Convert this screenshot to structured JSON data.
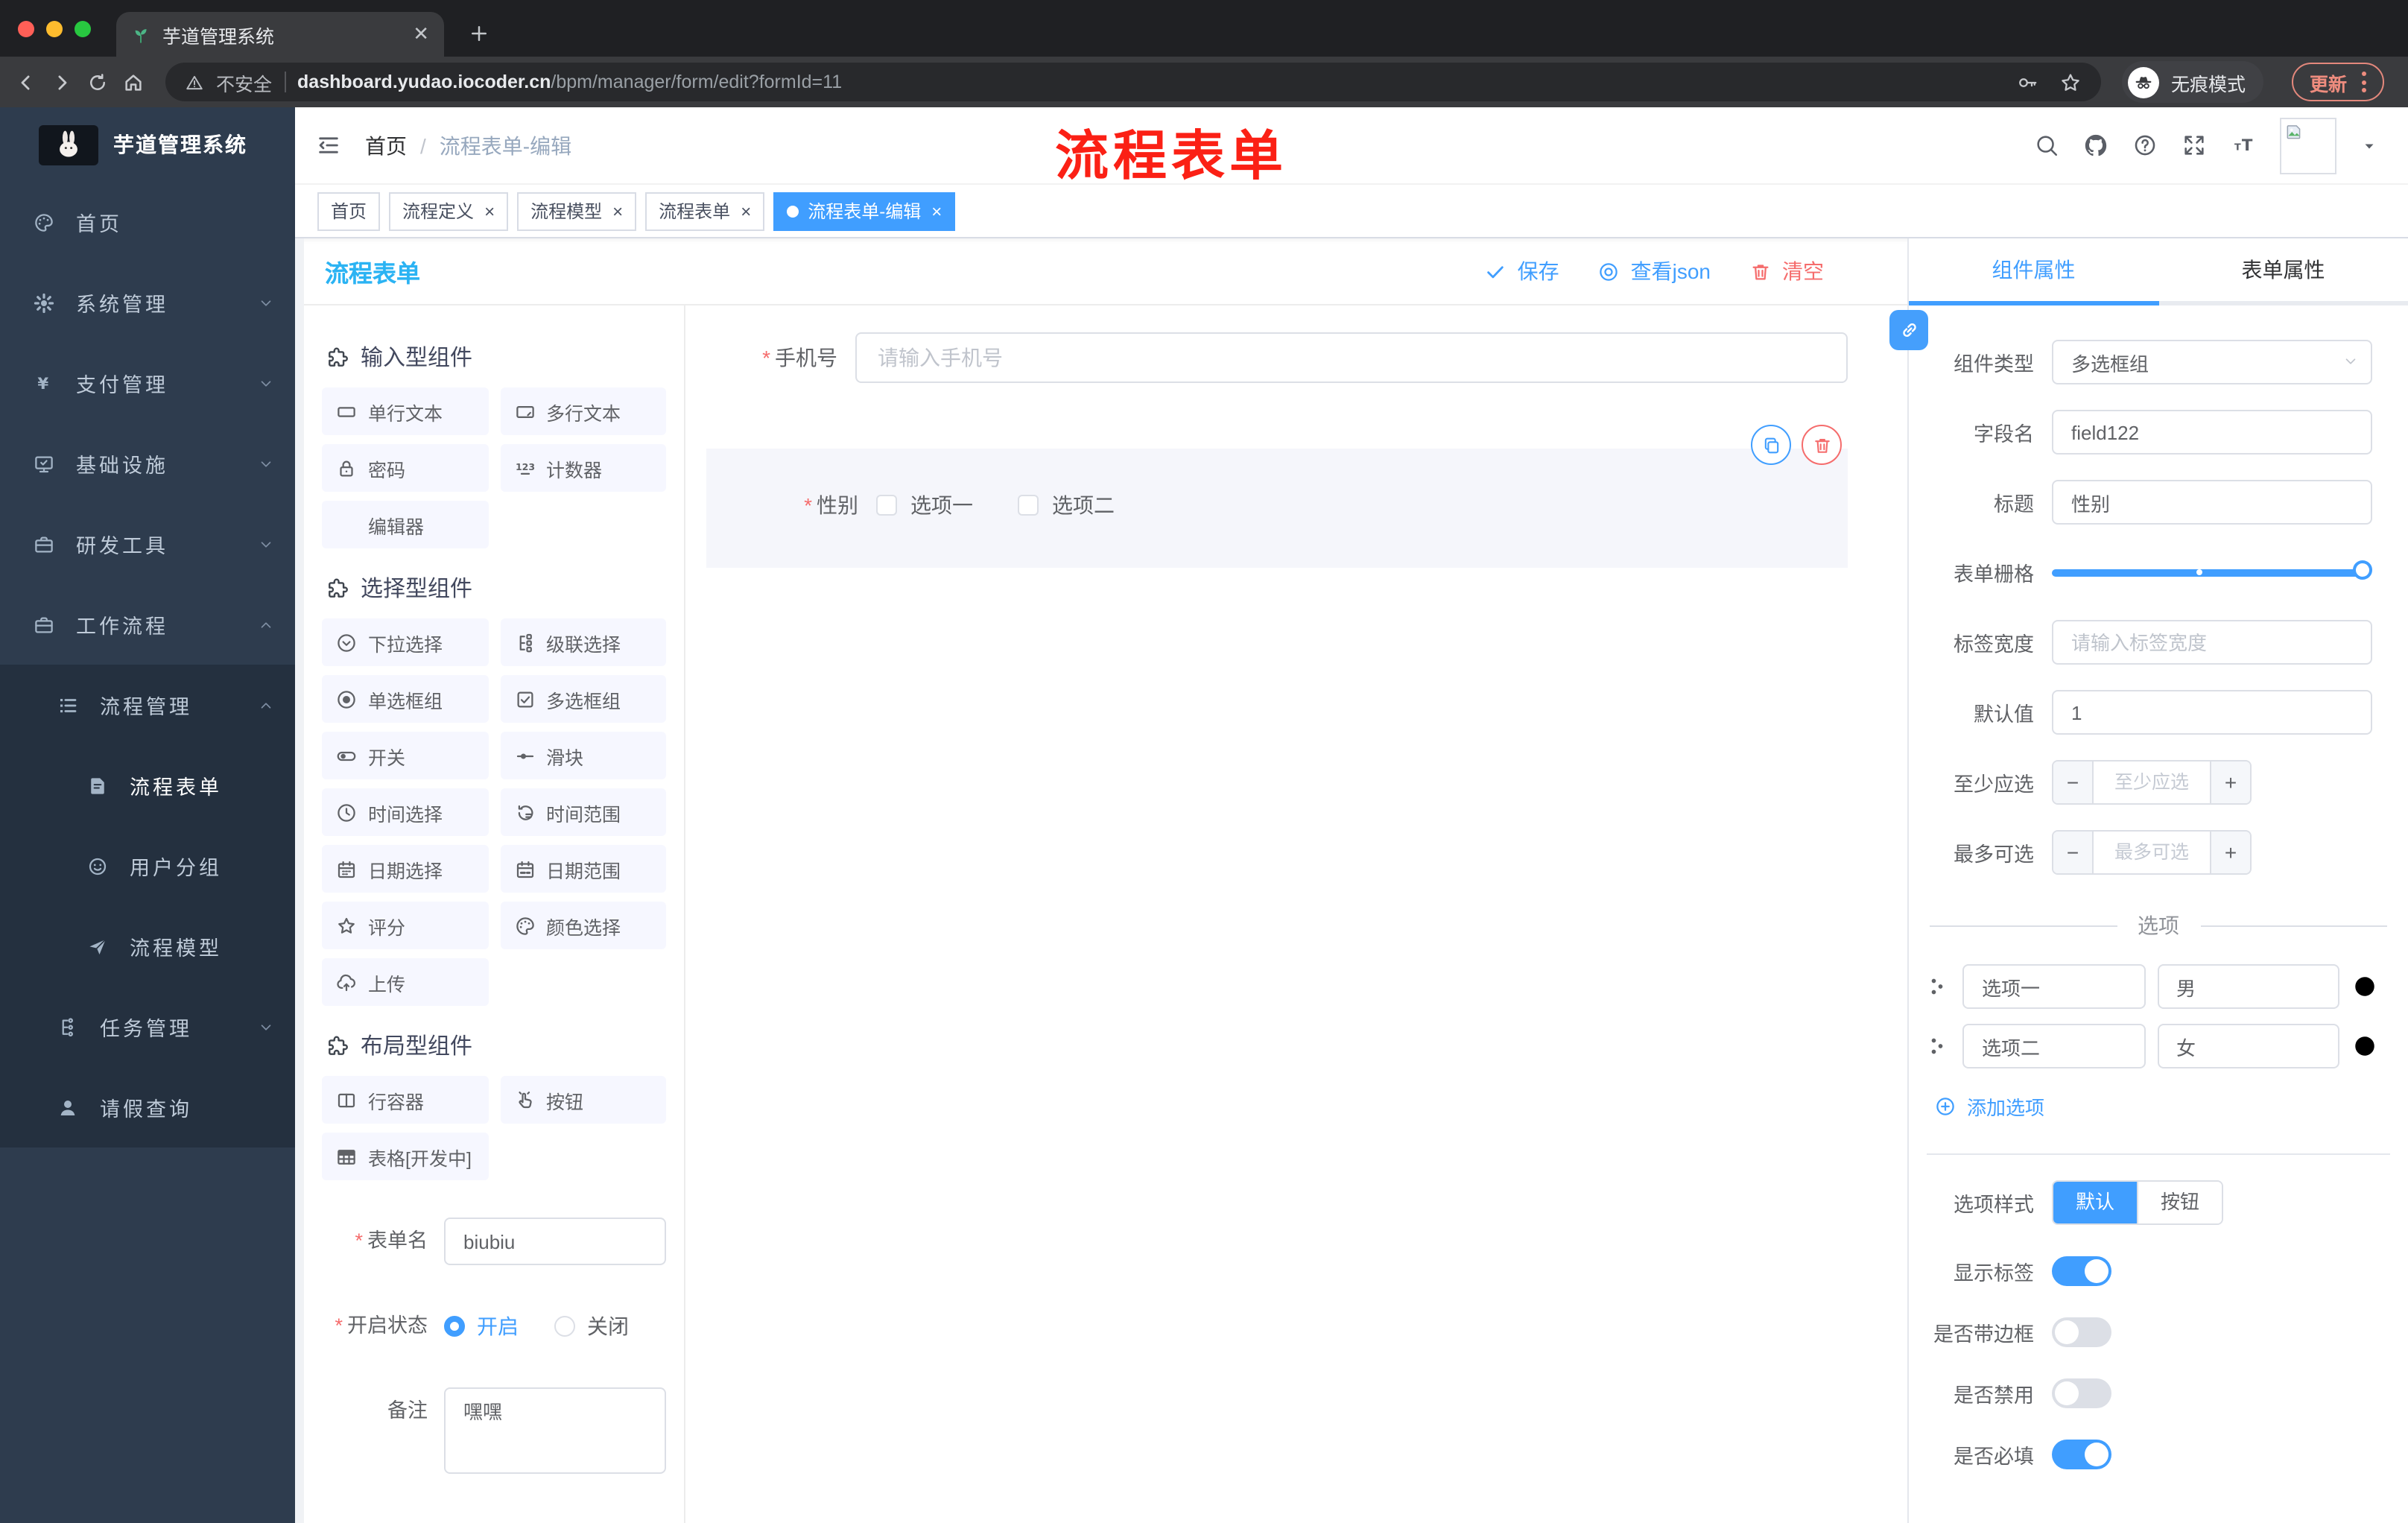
{
  "browser": {
    "tab_title": "芋道管理系统",
    "security_label": "不安全",
    "url_domain": "dashboard.yudao.iocoder.cn",
    "url_path": "/bpm/manager/form/edit?formId=11",
    "incognito_label": "无痕模式",
    "update_label": "更新"
  },
  "sidebar": {
    "logo_title": "芋道管理系统",
    "items": [
      {
        "label": "首页"
      },
      {
        "label": "系统管理"
      },
      {
        "label": "支付管理"
      },
      {
        "label": "基础设施"
      },
      {
        "label": "研发工具"
      },
      {
        "label": "工作流程"
      }
    ],
    "workflow": {
      "process_mgmt": "流程管理",
      "process_form": "流程表单",
      "user_group": "用户分组",
      "process_model": "流程模型",
      "task_mgmt": "任务管理",
      "leave_query": "请假查询"
    }
  },
  "header": {
    "breadcrumb_home": "首页",
    "breadcrumb_sep": "/",
    "breadcrumb_current": "流程表单-编辑",
    "annotation": "流程表单"
  },
  "tabs": [
    {
      "label": "首页",
      "closable": false
    },
    {
      "label": "流程定义",
      "closable": true
    },
    {
      "label": "流程模型",
      "closable": true
    },
    {
      "label": "流程表单",
      "closable": true
    },
    {
      "label": "流程表单-编辑",
      "closable": true,
      "active": true
    }
  ],
  "builder": {
    "title": "流程表单",
    "save_label": "保存",
    "view_json_label": "查看json",
    "clear_label": "清空",
    "sections": [
      {
        "title": "输入型组件",
        "items": [
          {
            "label": "单行文本",
            "icon": "input"
          },
          {
            "label": "多行文本",
            "icon": "textarea"
          },
          {
            "label": "密码",
            "icon": "lock"
          },
          {
            "label": "计数器",
            "icon": "counter"
          },
          {
            "label": "编辑器",
            "icon": ""
          }
        ]
      },
      {
        "title": "选择型组件",
        "items": [
          {
            "label": "下拉选择",
            "icon": "select"
          },
          {
            "label": "级联选择",
            "icon": "cascade"
          },
          {
            "label": "单选框组",
            "icon": "radio"
          },
          {
            "label": "多选框组",
            "icon": "checkbox"
          },
          {
            "label": "开关",
            "icon": "switch"
          },
          {
            "label": "滑块",
            "icon": "slider"
          },
          {
            "label": "时间选择",
            "icon": "clock"
          },
          {
            "label": "时间范围",
            "icon": "timerange"
          },
          {
            "label": "日期选择",
            "icon": "calendar"
          },
          {
            "label": "日期范围",
            "icon": "calrange"
          },
          {
            "label": "评分",
            "icon": "star"
          },
          {
            "label": "颜色选择",
            "icon": "palette"
          },
          {
            "label": "上传",
            "icon": "upload"
          }
        ]
      },
      {
        "title": "布局型组件",
        "items": [
          {
            "label": "行容器",
            "icon": "columns"
          },
          {
            "label": "按钮",
            "icon": "pointer"
          },
          {
            "label": "表格[开发中]",
            "icon": "table"
          }
        ]
      }
    ],
    "meta": {
      "name_label": "表单名",
      "name_value": "biubiu",
      "status_label": "开启状态",
      "status_on": "开启",
      "status_off": "关闭",
      "remark_label": "备注",
      "remark_value": "嘿嘿"
    },
    "canvas": {
      "phone": {
        "label": "手机号",
        "placeholder": "请输入手机号"
      },
      "gender": {
        "label": "性别",
        "options": [
          {
            "label": "选项一"
          },
          {
            "label": "选项二"
          }
        ]
      }
    }
  },
  "inspector": {
    "tab_component": "组件属性",
    "tab_form": "表单属性",
    "component_type_label": "组件类型",
    "component_type_value": "多选框组",
    "field_name_label": "字段名",
    "field_name_value": "field122",
    "title_label": "标题",
    "title_value": "性别",
    "grid_label": "表单栅格",
    "label_width_label": "标签宽度",
    "label_width_placeholder": "请输入标签宽度",
    "default_label": "默认值",
    "default_value": "1",
    "min_label": "至少应选",
    "min_placeholder": "至少应选",
    "max_label": "最多可选",
    "max_placeholder": "最多可选",
    "options_title": "选项",
    "options": [
      {
        "label": "选项一",
        "value": "男"
      },
      {
        "label": "选项二",
        "value": "女"
      }
    ],
    "add_option_label": "添加选项",
    "option_style_label": "选项样式",
    "option_style_default": "默认",
    "option_style_button": "按钮",
    "show_label_label": "显示标签",
    "border_label": "是否带边框",
    "disabled_label": "是否禁用",
    "required_label": "是否必填"
  },
  "colors": {
    "primary": "#409EFF",
    "danger": "#F56C6C",
    "title_blue": "#2BB3F3",
    "annotation_red": "#FB2015",
    "sidebar_bg": "#2E3C4E"
  }
}
